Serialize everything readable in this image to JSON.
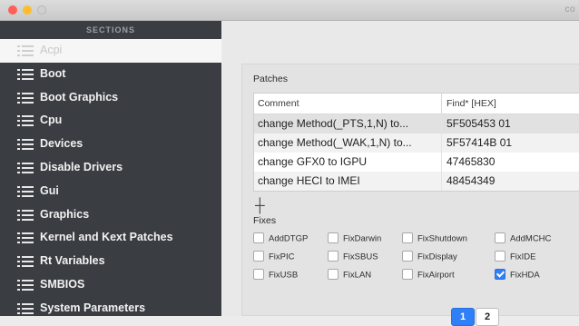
{
  "window": {
    "title": "co",
    "traffic_lights": [
      "#ff5f57",
      "#febc2e",
      "#d0d0d0"
    ]
  },
  "sidebar": {
    "header": "SECTIONS",
    "items": [
      {
        "label": "Acpi",
        "selected": true
      },
      {
        "label": "Boot"
      },
      {
        "label": "Boot Graphics"
      },
      {
        "label": "Cpu"
      },
      {
        "label": "Devices"
      },
      {
        "label": "Disable Drivers"
      },
      {
        "label": "Gui"
      },
      {
        "label": "Graphics"
      },
      {
        "label": "Kernel and Kext Patches"
      },
      {
        "label": "Rt Variables"
      },
      {
        "label": "SMBIOS"
      },
      {
        "label": "System Parameters"
      }
    ]
  },
  "patches": {
    "label": "Patches",
    "columns": [
      "Comment",
      "Find* [HEX]"
    ],
    "rows": [
      {
        "comment": "change Method(_PTS,1,N) to...",
        "find": "5F505453 01"
      },
      {
        "comment": "change Method(_WAK,1,N) to...",
        "find": "5F57414B 01"
      },
      {
        "comment": "change GFX0 to IGPU",
        "find": "47465830"
      },
      {
        "comment": "change HECI to IMEI",
        "find": "48454349"
      }
    ],
    "add_icon": "move-cross-icon"
  },
  "fixes": {
    "label": "Fixes",
    "items": [
      {
        "label": "AddDTGP",
        "checked": false
      },
      {
        "label": "FixDarwin",
        "checked": false
      },
      {
        "label": "FixShutdown",
        "checked": false
      },
      {
        "label": "AddMCHC",
        "checked": false
      },
      {
        "label": "FixPIC",
        "checked": false
      },
      {
        "label": "FixSBUS",
        "checked": false
      },
      {
        "label": "FixDisplay",
        "checked": false
      },
      {
        "label": "FixIDE",
        "checked": false
      },
      {
        "label": "FixUSB",
        "checked": false
      },
      {
        "label": "FixLAN",
        "checked": false
      },
      {
        "label": "FixAirport",
        "checked": false
      },
      {
        "label": "FixHDA",
        "checked": true
      }
    ]
  },
  "pager": {
    "pages": [
      "1",
      "2"
    ],
    "current": "1"
  },
  "colors": {
    "accent": "#2f7ff7",
    "sidebar_bg": "#3a3d41"
  }
}
